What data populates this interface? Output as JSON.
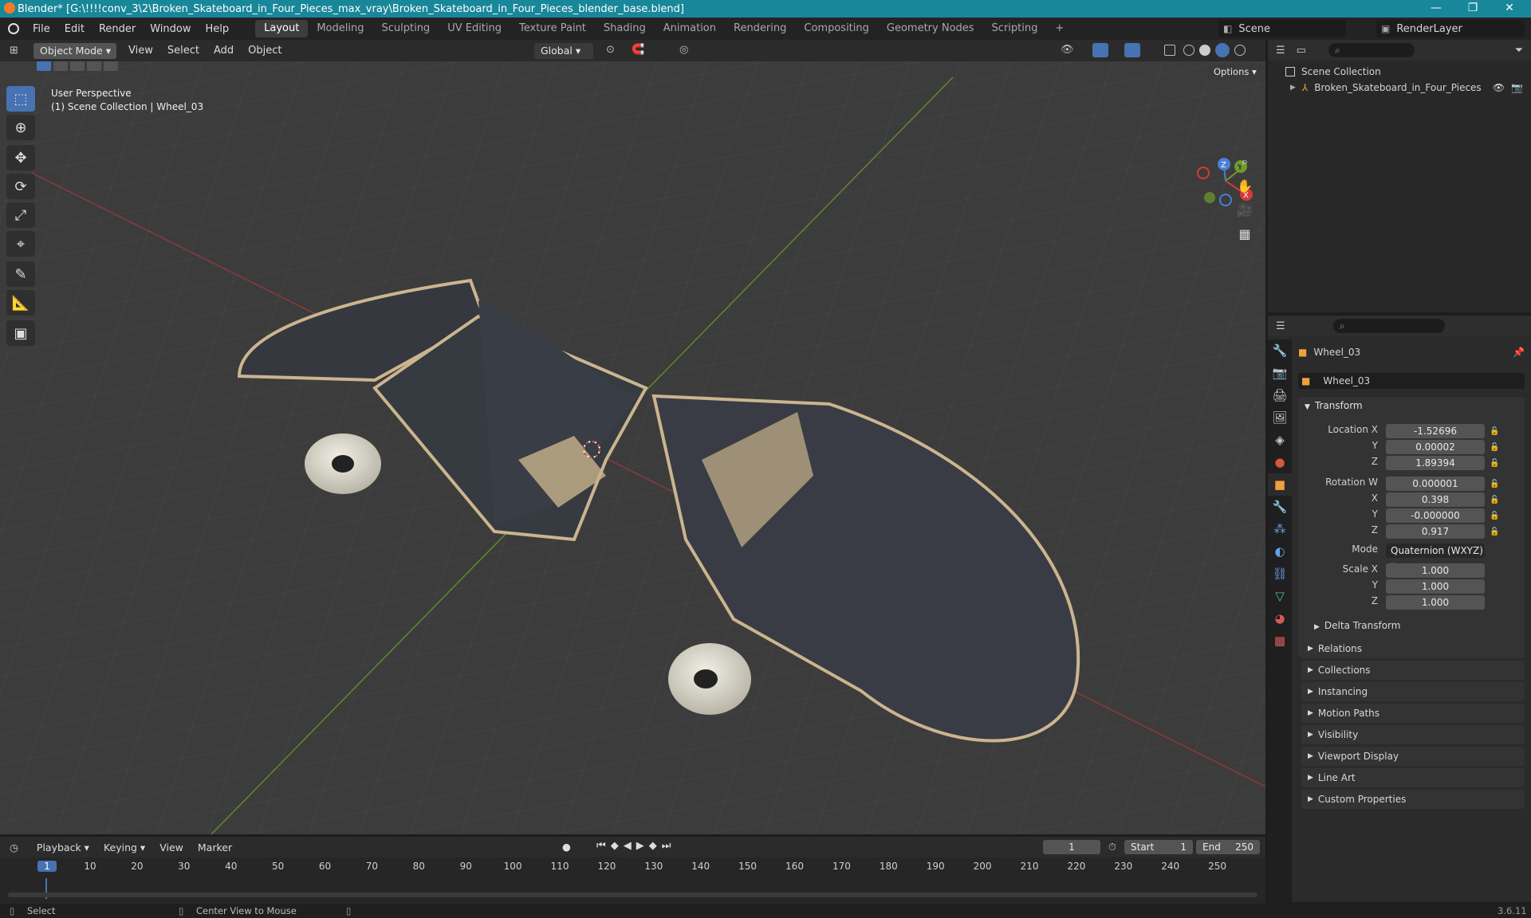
{
  "window": {
    "title": "Blender* [G:\\!!!!conv_3\\2\\Broken_Skateboard_in_Four_Pieces_max_vray\\Broken_Skateboard_in_Four_Pieces_blender_base.blend]",
    "minimize": "—",
    "maximize": "❐",
    "close": "✕"
  },
  "menu": [
    "File",
    "Edit",
    "Render",
    "Window",
    "Help"
  ],
  "workspaces": [
    "Layout",
    "Modeling",
    "Sculpting",
    "UV Editing",
    "Texture Paint",
    "Shading",
    "Animation",
    "Rendering",
    "Compositing",
    "Geometry Nodes",
    "Scripting",
    "+"
  ],
  "scene": {
    "name": "Scene",
    "view_layer": "RenderLayer"
  },
  "viewport_header": {
    "mode": "Object Mode",
    "menus": [
      "View",
      "Select",
      "Add",
      "Object"
    ],
    "orientation": "Global",
    "options": "Options"
  },
  "viewport": {
    "perspective": "User Perspective",
    "collection_info": "(1) Scene Collection | Wheel_03",
    "axis_x": "X",
    "axis_y": "Y",
    "axis_z": "Z"
  },
  "outliner": {
    "root": "Scene Collection",
    "item": "Broken_Skateboard_in_Four_Pieces"
  },
  "properties": {
    "object_name": "Wheel_03",
    "datablock": "Wheel_03",
    "transform_title": "Transform",
    "location": {
      "label": "Location X",
      "x": "-1.52696",
      "y": "0.00002",
      "z": "1.89394"
    },
    "rotation": {
      "label": "Rotation W",
      "w": "0.000001",
      "x": "0.398",
      "y": "-0.000000",
      "z": "0.917"
    },
    "mode_label": "Mode",
    "mode_value": "Quaternion (WXYZ)",
    "scale": {
      "label": "Scale X",
      "x": "1.000",
      "y": "1.000",
      "z": "1.000"
    },
    "sub_labels": {
      "y": "Y",
      "z": "Z",
      "x": "X"
    },
    "delta": "Delta Transform",
    "panels": [
      "Relations",
      "Collections",
      "Instancing",
      "Motion Paths",
      "Visibility",
      "Viewport Display",
      "Line Art",
      "Custom Properties"
    ]
  },
  "timeline": {
    "menus": [
      "Playback",
      "Keying",
      "View",
      "Marker"
    ],
    "current_frame": "1",
    "start_label": "Start",
    "start": "1",
    "end_label": "End",
    "end": "250",
    "ticks": [
      "1",
      "10",
      "20",
      "30",
      "40",
      "50",
      "60",
      "70",
      "80",
      "90",
      "100",
      "110",
      "120",
      "130",
      "140",
      "150",
      "160",
      "170",
      "180",
      "190",
      "200",
      "210",
      "220",
      "230",
      "240",
      "250"
    ]
  },
  "status": {
    "select": "Select",
    "center": "Center View to Mouse",
    "version": "3.6.11"
  }
}
